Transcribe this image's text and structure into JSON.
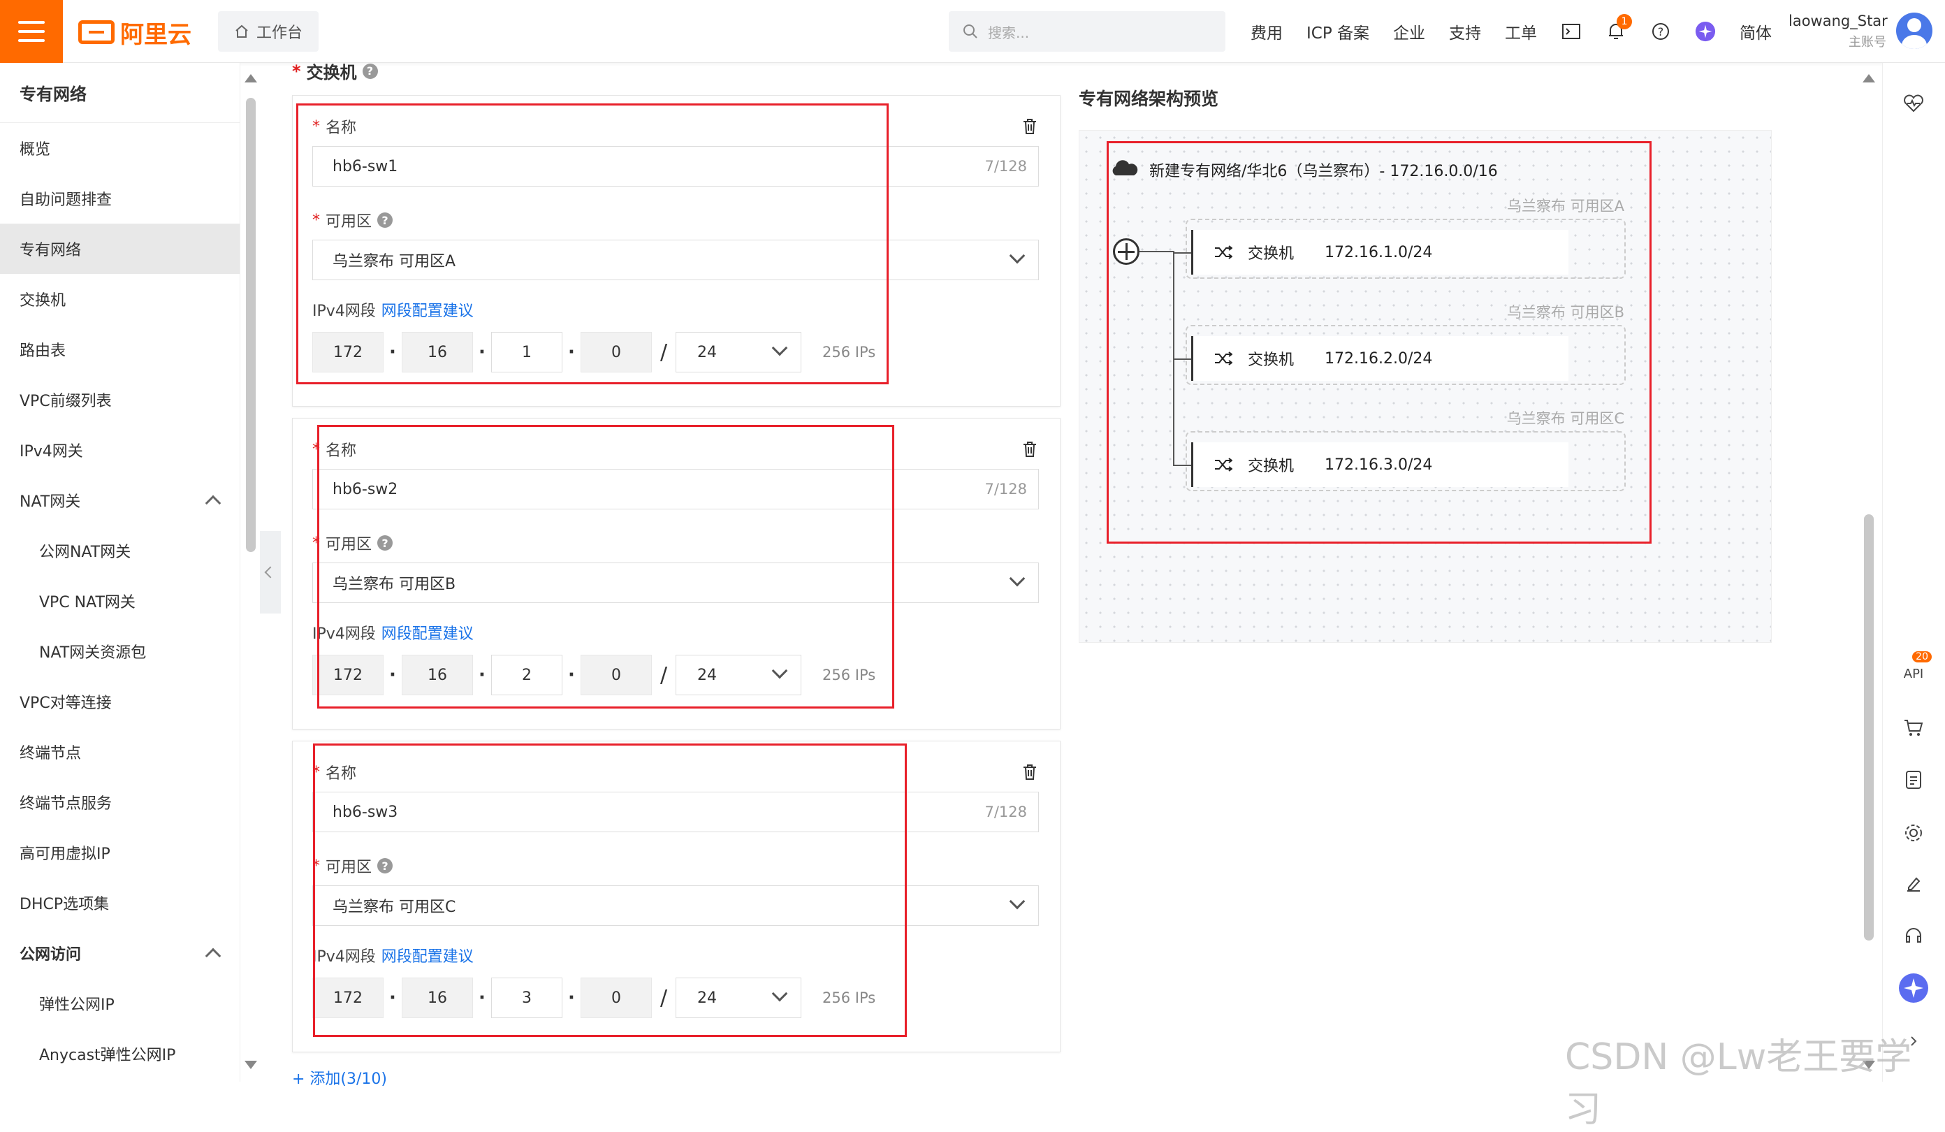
{
  "header": {
    "logo_text": "阿里云",
    "workbench": "工作台",
    "search_placeholder": "搜索...",
    "nav": [
      "费用",
      "ICP 备案",
      "企业",
      "支持",
      "工单"
    ],
    "notification_count": "1",
    "lang": "简体",
    "user_name": "laowang_Star",
    "user_role": "主账号"
  },
  "sidebar": {
    "title": "专有网络",
    "items": [
      {
        "label": "概览"
      },
      {
        "label": "自助问题排查"
      },
      {
        "label": "专有网络"
      },
      {
        "label": "交换机"
      },
      {
        "label": "路由表"
      },
      {
        "label": "VPC前缀列表"
      },
      {
        "label": "IPv4网关"
      },
      {
        "label": "NAT网关"
      },
      {
        "label": "公网NAT网关"
      },
      {
        "label": "VPC NAT网关"
      },
      {
        "label": "NAT网关资源包"
      },
      {
        "label": "VPC对等连接"
      },
      {
        "label": "终端节点"
      },
      {
        "label": "终端节点服务"
      },
      {
        "label": "高可用虚拟IP"
      },
      {
        "label": "DHCP选项集"
      },
      {
        "label": "公网访问"
      },
      {
        "label": "弹性公网IP"
      },
      {
        "label": "Anycast弹性公网IP"
      }
    ]
  },
  "form": {
    "section_label": "交换机",
    "name_label": "名称",
    "zone_label": "可用区",
    "ipv4_label": "IPv4网段",
    "ipv4_link": "网段配置建议",
    "add_link": "+ 添加(3/10)",
    "switches": [
      {
        "name": "hb6-sw1",
        "count": "7/128",
        "zone": "乌兰察布 可用区A",
        "octets": [
          "172",
          "16",
          "1",
          "0"
        ],
        "mask": "24",
        "ips": "256 IPs"
      },
      {
        "name": "hb6-sw2",
        "count": "7/128",
        "zone": "乌兰察布 可用区B",
        "octets": [
          "172",
          "16",
          "2",
          "0"
        ],
        "mask": "24",
        "ips": "256 IPs"
      },
      {
        "name": "hb6-sw3",
        "count": "7/128",
        "zone": "乌兰察布 可用区C",
        "octets": [
          "172",
          "16",
          "3",
          "0"
        ],
        "mask": "24",
        "ips": "256 IPs"
      }
    ]
  },
  "preview": {
    "title": "专有网络架构预览",
    "vpc_line": "新建专有网络/华北6（乌兰察布）- 172.16.0.0/16",
    "zones": [
      {
        "zone": "乌兰察布 可用区A",
        "switch_label": "交换机",
        "cidr": "172.16.1.0/24"
      },
      {
        "zone": "乌兰察布 可用区B",
        "switch_label": "交换机",
        "cidr": "172.16.2.0/24"
      },
      {
        "zone": "乌兰察布 可用区C",
        "switch_label": "交换机",
        "cidr": "172.16.3.0/24"
      }
    ]
  },
  "right_rail": {
    "api_label": "API",
    "api_badge": "20"
  },
  "watermark": "CSDN @Lw老王要学习",
  "colors": {
    "brand": "#ff6a00",
    "link": "#1a73e8",
    "highlight_border": "#e8202a"
  }
}
